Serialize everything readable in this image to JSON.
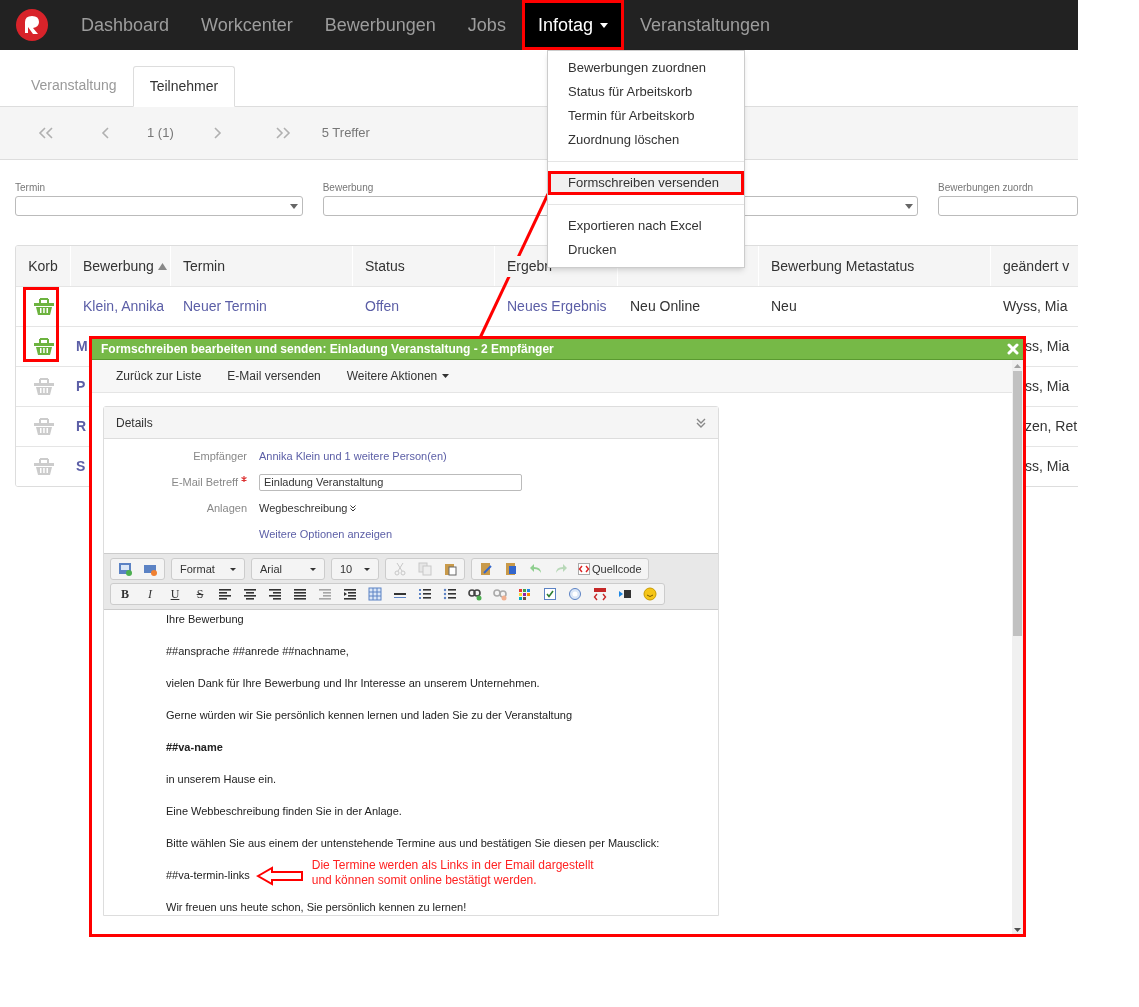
{
  "navbar": {
    "items": [
      {
        "label": "Dashboard",
        "selected": false,
        "dropdown": false
      },
      {
        "label": "Workcenter",
        "selected": false,
        "dropdown": false
      },
      {
        "label": "Bewerbungen",
        "selected": false,
        "dropdown": false
      },
      {
        "label": "Jobs",
        "selected": false,
        "dropdown": false
      },
      {
        "label": "Infotag",
        "selected": true,
        "dropdown": true
      },
      {
        "label": "Veranstaltungen",
        "selected": false,
        "dropdown": false
      }
    ]
  },
  "tabs": [
    {
      "label": "Veranstaltung",
      "selected": false
    },
    {
      "label": "Teilnehmer",
      "selected": true
    }
  ],
  "pager": {
    "page": "1 (1)",
    "hits": "5 Treffer"
  },
  "filters": [
    {
      "kind": "select",
      "label": "Termin"
    },
    {
      "kind": "select",
      "label": "Bewerbung"
    },
    {
      "kind": "select"
    },
    {
      "kind": "text",
      "label": "Bewerbungen zuordn"
    }
  ],
  "table": {
    "columns": [
      {
        "label": "Korb",
        "sorted": false
      },
      {
        "label": "Bewerbung",
        "sorted": true
      },
      {
        "label": "Termin",
        "sorted": false
      },
      {
        "label": "Status",
        "sorted": false
      },
      {
        "label": "Ergebn",
        "sorted": false
      },
      {
        "sorted": false
      },
      {
        "label": "Bewerbung Metastatus",
        "sorted": false
      },
      {
        "label": "geändert v",
        "sorted": false
      }
    ],
    "rows": [
      {
        "kind": "full",
        "in_basket": true,
        "cells": [
          "",
          "Klein, Annika",
          "Neuer Termin",
          "Offen",
          "Neues Ergebnis",
          "Neu Online",
          "Neu",
          "Wyss, Mia"
        ]
      },
      {
        "kind": "covered",
        "in_basket": true,
        "cells": [
          "",
          "M",
          null,
          null,
          null,
          null,
          null,
          "ss, Mia"
        ]
      },
      {
        "kind": "covered",
        "in_basket": false,
        "cells": [
          "",
          "P",
          null,
          null,
          null,
          null,
          null,
          "ss, Mia"
        ]
      },
      {
        "kind": "covered",
        "in_basket": false,
        "cells": [
          "",
          "R",
          null,
          null,
          null,
          null,
          null,
          "zen, Ret"
        ]
      },
      {
        "kind": "covered",
        "in_basket": false,
        "cells": [
          "",
          "S",
          null,
          null,
          null,
          null,
          null,
          "ss, Mia"
        ]
      }
    ]
  },
  "menu": {
    "items": [
      {
        "kind": "item",
        "label": "Bewerbungen zuordnen",
        "highlighted": false
      },
      {
        "kind": "item",
        "label": "Status für Arbeitskorb",
        "highlighted": false
      },
      {
        "kind": "item",
        "label": "Termin für Arbeitskorb",
        "highlighted": false
      },
      {
        "kind": "item",
        "label": "Zuordnung löschen",
        "highlighted": false
      },
      {
        "kind": "divider"
      },
      {
        "kind": "item",
        "label": "Formschreiben versenden",
        "highlighted": true
      },
      {
        "kind": "divider"
      },
      {
        "kind": "item",
        "label": "Exportieren nach Excel",
        "highlighted": false
      },
      {
        "kind": "item",
        "label": "Drucken",
        "highlighted": false
      }
    ]
  },
  "dialog": {
    "title": "Formschreiben bearbeiten und senden: Einladung Veranstaltung - 2 Empfänger",
    "toolbar": [
      {
        "label": "Zurück zur Liste",
        "dropdown": false
      },
      {
        "label": "E-Mail versenden",
        "dropdown": false
      },
      {
        "label": "Weitere Aktionen",
        "dropdown": true
      }
    ],
    "details": {
      "title": "Details",
      "fields": [
        {
          "kind": "link",
          "label": "Empfänger",
          "value": "Annika Klein und 1 weitere Person(en)",
          "required": false
        },
        {
          "kind": "input",
          "label": "E-Mail Betreff",
          "value": "Einladung Veranstaltung",
          "required": true
        },
        {
          "kind": "attachment",
          "label": "Anlagen",
          "value": "Wegbeschreibung",
          "required": false
        },
        {
          "kind": "link",
          "value": "Weitere Optionen anzeigen"
        }
      ]
    },
    "editor": {
      "format": "Format",
      "font": "Arial",
      "size": "10",
      "source_button": "Quellcode",
      "style_buttons": [
        "B",
        "I",
        "U",
        "S"
      ],
      "paragraphs": [
        {
          "text": "Ihre Bewerbung",
          "bold": false
        },
        {
          "text": "##ansprache ##anrede ##nachname,",
          "bold": false
        },
        {
          "text": "vielen Dank für Ihre Bewerbung und Ihr Interesse an unserem Unternehmen.",
          "bold": false
        },
        {
          "text": "Gerne würden wir Sie persönlich kennen lernen und laden Sie zu der Veranstaltung",
          "bold": false
        },
        {
          "text": "##va-name",
          "bold": true
        },
        {
          "text": "in unserem Hause ein.",
          "bold": false
        },
        {
          "text": "Eine Webbeschreibung finden Sie in der Anlage.",
          "bold": false
        },
        {
          "text": "Bitte wählen Sie aus einem der untenstehende Termine aus und bestätigen Sie diesen per Mausclick:",
          "bold": false
        },
        {
          "text": "##va-termin-links",
          "bold": false,
          "callout": [
            "Die Termine werden als Links in der Email dargestellt",
            "und können somit online bestätigt werden."
          ]
        },
        {
          "text": "Wir freuen uns heute schon, Sie persönlich kennen zu lernen!",
          "bold": false
        }
      ]
    }
  }
}
